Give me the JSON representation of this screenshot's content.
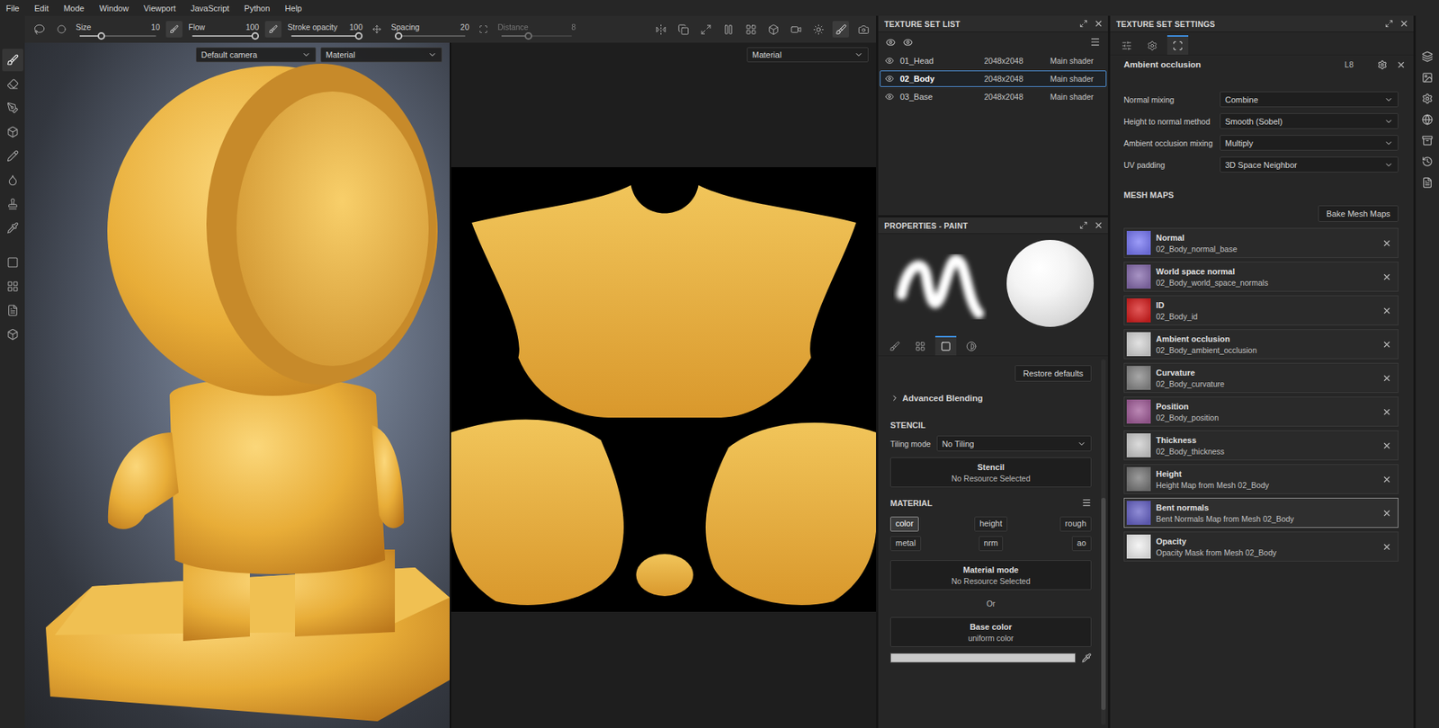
{
  "menu": [
    "File",
    "Edit",
    "Mode",
    "Window",
    "Viewport",
    "JavaScript",
    "Python",
    "Help"
  ],
  "tool_groups": [
    [
      {
        "selected": true
      },
      {
        "selected": false
      },
      {
        "selected": false
      },
      {
        "selected": false
      },
      {
        "selected": false
      },
      {
        "selected": false
      },
      {
        "selected": false
      },
      {
        "selected": false
      }
    ],
    [
      {
        "selected": false
      },
      {
        "selected": false
      },
      {
        "selected": false
      },
      {
        "selected": false
      }
    ]
  ],
  "toolbar": {
    "sliders": [
      {
        "label": "Size",
        "value": "10",
        "level": 0.28,
        "disabled": false
      },
      {
        "label": "Flow",
        "value": "100",
        "level": 1,
        "disabled": false
      },
      {
        "label": "Stroke opacity",
        "value": "100",
        "level": 1,
        "disabled": false
      },
      {
        "label": "Spacing",
        "value": "20",
        "level": 0.05,
        "disabled": false
      },
      {
        "label": "Distance",
        "value": "8",
        "level": 0.38,
        "disabled": true
      }
    ]
  },
  "viewport3d": {
    "camera": "Default camera",
    "mode": "Material"
  },
  "viewport2d": {
    "mode": "Material"
  },
  "texture_set_list": {
    "title": "TEXTURE SET LIST",
    "rows": [
      {
        "name": "01_Head",
        "resolution": "2048x2048",
        "shader": "Main shader",
        "selected": false
      },
      {
        "name": "02_Body",
        "resolution": "2048x2048",
        "shader": "Main shader",
        "selected": true
      },
      {
        "name": "03_Base",
        "resolution": "2048x2048",
        "shader": "Main shader",
        "selected": false
      }
    ]
  },
  "properties": {
    "title": "PROPERTIES - PAINT",
    "tabs": [
      {
        "selected": false
      },
      {
        "selected": false
      },
      {
        "selected": true
      },
      {
        "selected": false
      }
    ],
    "restore": "Restore defaults",
    "advanced": {
      "label": "Advanced Blending",
      "expanded": false
    },
    "stencil": {
      "heading": "STENCIL",
      "tiling_label": "Tiling mode",
      "tiling_value": "No Tiling",
      "button_title": "Stencil",
      "button_sub": "No Resource Selected"
    },
    "material": {
      "heading": "MATERIAL",
      "channels": [
        {
          "label": "color",
          "selected": true
        },
        {
          "label": "height",
          "selected": false
        },
        {
          "label": "rough",
          "selected": false
        },
        {
          "label": "metal",
          "selected": false
        },
        {
          "label": "nrm",
          "selected": false
        },
        {
          "label": "ao",
          "selected": false
        }
      ],
      "mode_title": "Material mode",
      "mode_sub": "No Resource Selected",
      "or": "Or",
      "base_title": "Base color",
      "base_sub": "uniform color"
    }
  },
  "texture_set_settings": {
    "title": "TEXTURE SET SETTINGS",
    "tabs": [
      {
        "selected": false
      },
      {
        "selected": false
      },
      {
        "selected": true
      }
    ],
    "channel": {
      "name": "Ambient occlusion",
      "format": "L8"
    },
    "settings": [
      {
        "label": "Normal mixing",
        "value": "Combine"
      },
      {
        "label": "Height to normal method",
        "value": "Smooth (Sobel)"
      },
      {
        "label": "Ambient occlusion mixing",
        "value": "Multiply"
      },
      {
        "label": "UV padding",
        "value": "3D Space Neighbor"
      }
    ],
    "mesh_maps": {
      "heading": "MESH MAPS",
      "bake": "Bake Mesh Maps",
      "maps": [
        {
          "name": "Normal",
          "file": "02_Body_normal_base",
          "color": "#7b7bf6",
          "highlighted": false
        },
        {
          "name": "World space normal",
          "file": "02_Body_world_space_normals",
          "color": "#8a6fb0",
          "highlighted": false
        },
        {
          "name": "ID",
          "file": "02_Body_id",
          "color": "#d82222",
          "highlighted": false
        },
        {
          "name": "Ambient occlusion",
          "file": "02_Body_ambient_occlusion",
          "color": "#d8d8d8",
          "highlighted": false
        },
        {
          "name": "Curvature",
          "file": "02_Body_curvature",
          "color": "#8a8a8a",
          "highlighted": false
        },
        {
          "name": "Position",
          "file": "02_Body_position",
          "color": "#a4609c",
          "highlighted": false
        },
        {
          "name": "Thickness",
          "file": "02_Body_thickness",
          "color": "#cfcfcf",
          "highlighted": false
        },
        {
          "name": "Height",
          "file": "Height Map from Mesh 02_Body",
          "color": "#7a7a7a",
          "highlighted": false
        },
        {
          "name": "Bent normals",
          "file": "Bent Normals Map from Mesh 02_Body",
          "color": "#6a66c8",
          "highlighted": true
        },
        {
          "name": "Opacity",
          "file": "Opacity Mask from Mesh 02_Body",
          "color": "#f2f2f2",
          "highlighted": false
        }
      ]
    }
  }
}
